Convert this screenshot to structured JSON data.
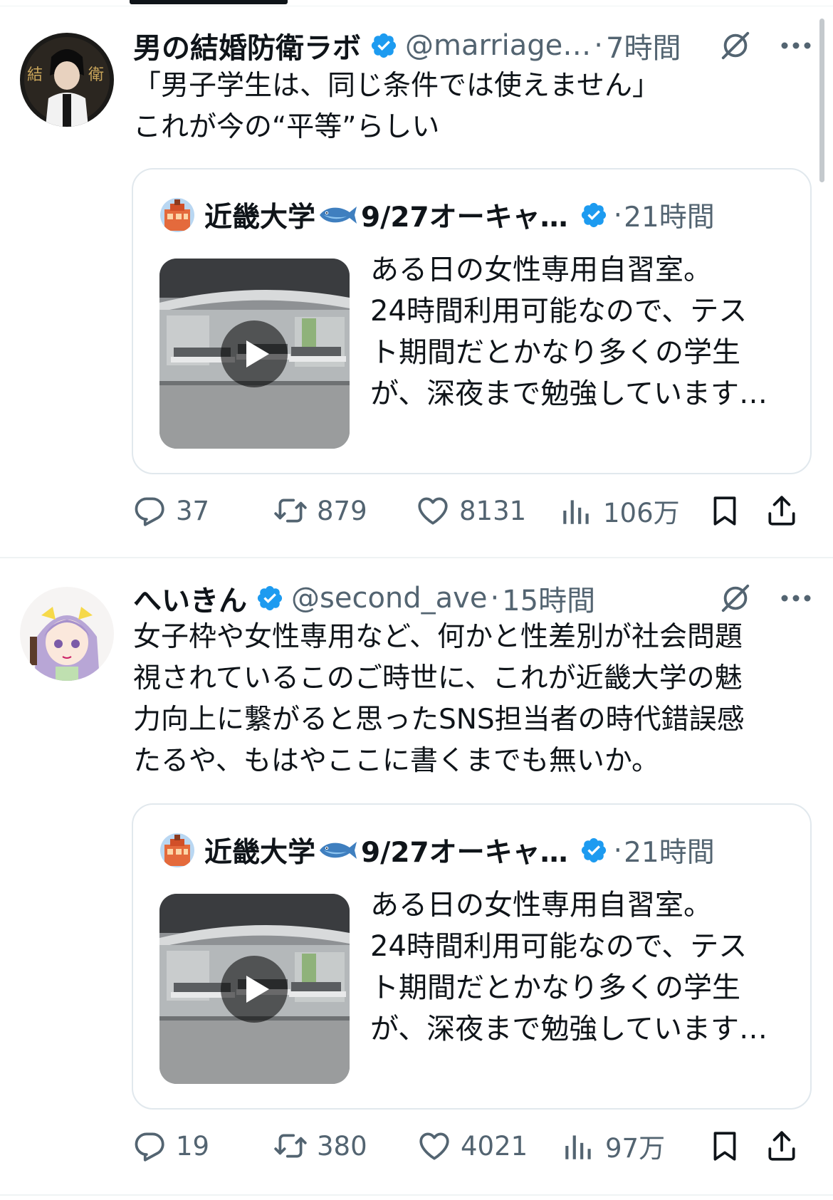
{
  "colors": {
    "verified": "#1d9bf0",
    "secondary_text": "#536471",
    "primary_text": "#0f1419",
    "border": "#e1e8ed"
  },
  "tweets": [
    {
      "author_name": "男の結婚防衛ラボ",
      "author_handle": "@marriage…",
      "separator": "·",
      "time": "7時間",
      "text": "「男子学生は、同じ条件では使えません」\nこれが今の“平等”らしい",
      "quote": {
        "author_name": "近畿大学",
        "author_name_suffix": "9/27オーキャ…",
        "separator": "·",
        "time": "21時間",
        "text_lines": [
          "ある日の女性専用自習室。",
          "24時間利用可能なので、テス",
          "ト期間だとかなり多くの学生",
          "が、深夜まで勉強しています…"
        ]
      },
      "stats": {
        "replies": "37",
        "reposts": "879",
        "likes": "8131",
        "views": "106万"
      }
    },
    {
      "author_name": "へいきん",
      "author_handle": "@second_ave",
      "separator": "·",
      "time": "15時間",
      "text": "女子枠や女性専用など、何かと性差別が社会問題\n視されているこのご時世に、これが近畿大学の魅\n力向上に繋がると思ったSNS担当者の時代錯誤感\nたるや、もはやここに書くまでも無いか。",
      "quote": {
        "author_name": "近畿大学",
        "author_name_suffix": "9/27オーキャ…",
        "separator": "·",
        "time": "21時間",
        "text_lines": [
          "ある日の女性専用自習室。",
          "24時間利用可能なので、テス",
          "ト期間だとかなり多くの学生",
          "が、深夜まで勉強しています…"
        ]
      },
      "stats": {
        "replies": "19",
        "reposts": "380",
        "likes": "4021",
        "views": "97万"
      }
    }
  ]
}
